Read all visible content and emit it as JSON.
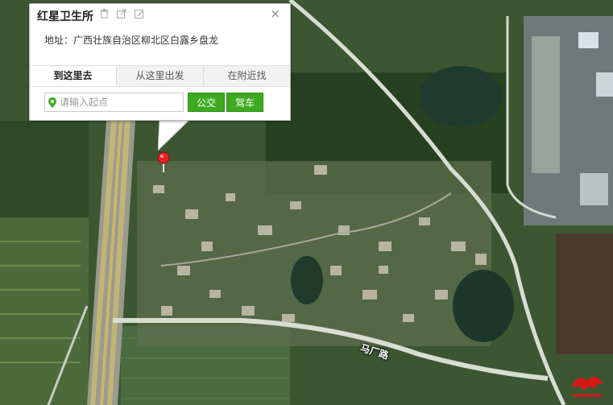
{
  "popup": {
    "title": "红星卫生所",
    "address": "地址：广西壮族自治区柳北区白露乡盘龙",
    "tabs": [
      {
        "label": "到这里去",
        "active": true
      },
      {
        "label": "从这里出发",
        "active": false
      },
      {
        "label": "在附近找",
        "active": false
      }
    ],
    "start_input": {
      "placeholder": "请输入起点",
      "value": ""
    },
    "buttons": {
      "bus": "公交",
      "drive": "驾车"
    },
    "close_glyph": "×",
    "tool_icons": [
      "trash-icon",
      "share-icon",
      "edit-icon"
    ]
  },
  "map": {
    "road_label": "马厂路",
    "marker_color": "#e52222",
    "accent_green": "#3eaa22"
  }
}
